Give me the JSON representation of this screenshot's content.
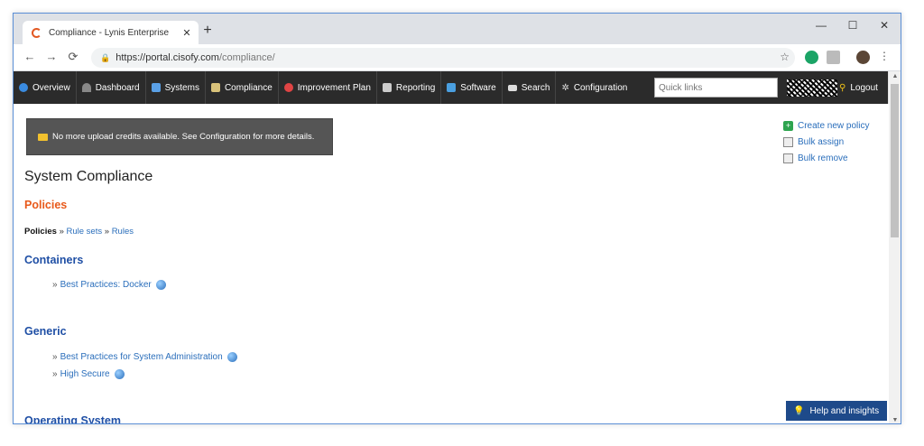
{
  "browser": {
    "tab_title": "Compliance - Lynis Enterprise",
    "tab_close": "✕",
    "new_tab": "+",
    "url_host": "https://portal.cisofy.com",
    "url_path": "/compliance/",
    "controls": {
      "minimize": "—",
      "maximize": "☐",
      "close": "✕"
    }
  },
  "nav": {
    "items": [
      {
        "label": "Overview",
        "icon": "globe-icon",
        "color": "#3a8be0"
      },
      {
        "label": "Dashboard",
        "icon": "dashboard-icon",
        "color": "#888888"
      },
      {
        "label": "Systems",
        "icon": "monitor-icon",
        "color": "#5aa0e6"
      },
      {
        "label": "Compliance",
        "icon": "clipboard-icon",
        "color": "#d9c27a"
      },
      {
        "label": "Improvement Plan",
        "icon": "target-icon",
        "color": "#e04444"
      },
      {
        "label": "Reporting",
        "icon": "report-icon",
        "color": "#cccccc"
      },
      {
        "label": "Software",
        "icon": "software-icon",
        "color": "#4a9fe0"
      },
      {
        "label": "Search",
        "icon": "search-icon",
        "color": "#dddddd"
      },
      {
        "label": "Configuration",
        "icon": "gear-icon",
        "color": "#dddddd"
      }
    ],
    "quick_links_placeholder": "Quick links",
    "logout": "Logout"
  },
  "alert": {
    "text": "No more upload credits available. See Configuration for more details."
  },
  "actions": {
    "create": "Create new policy",
    "bulk_assign": "Bulk assign",
    "bulk_remove": "Bulk remove"
  },
  "page": {
    "title": "System Compliance",
    "subtitle": "Policies",
    "breadcrumb": {
      "current": "Policies",
      "sep": "»",
      "rule_sets": "Rule sets",
      "rules": "Rules"
    }
  },
  "sections": [
    {
      "title": "Containers",
      "items": [
        "Best Practices: Docker"
      ]
    },
    {
      "title": "Generic",
      "items": [
        "Best Practices for System Administration",
        "High Secure"
      ]
    },
    {
      "title": "Operating System",
      "items": []
    }
  ],
  "help_button": "Help and insights"
}
